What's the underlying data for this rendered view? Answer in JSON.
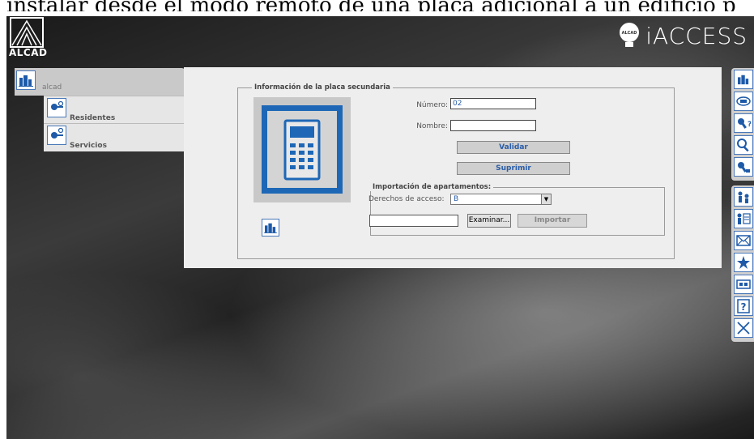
{
  "top_text": "instalar desde el modo remoto de una placa adicional a un edificio p",
  "header": {
    "left_logo_text": "ALCAD",
    "right_logo_text": "iACCESS",
    "right_logo_badge": "ALCAD"
  },
  "sidebar": {
    "home_label": "alcad",
    "items": [
      {
        "label": "Residentes",
        "icon": "residents-key-icon"
      },
      {
        "label": "Servicios",
        "icon": "services-key-icon"
      }
    ]
  },
  "form": {
    "legend": "Información de la placa secundaria",
    "numero_label": "Número:",
    "numero_value": "02",
    "nombre_label": "Nombre:",
    "nombre_value": "",
    "validar_label": "Validar",
    "suprimir_label": "Suprimir"
  },
  "import": {
    "legend": "Importación de apartamentos:",
    "derechos_label": "Derechos de acceso:",
    "derechos_value": "B",
    "examinar_label": "Examinar...",
    "importar_label": "Importar"
  },
  "right_toolbar": [
    "building-icon",
    "camera-tag-icon",
    "key-question-icon",
    "search-icon",
    "key-edit-icon",
    "users-icon",
    "user-list-icon",
    "mail-icon",
    "star-icon",
    "device-icon",
    "help-icon",
    "close-icon"
  ],
  "colors": {
    "accent": "#1e67b6",
    "panel": "#eeeeee"
  }
}
